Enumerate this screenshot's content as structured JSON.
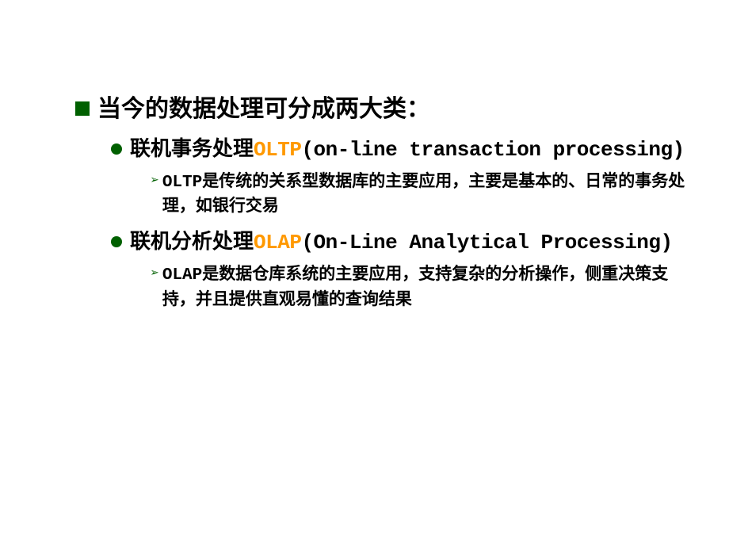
{
  "main": {
    "title": "当今的数据处理可分成两大类：",
    "items": [
      {
        "prefix": "联机事务处理",
        "acronym": "OLTP",
        "suffix": "(on-line transaction processing)",
        "detail": "OLTP是传统的关系型数据库的主要应用，主要是基本的、日常的事务处理，如银行交易"
      },
      {
        "prefix": "联机分析处理",
        "acronym": "OLAP",
        "suffix": "(On-Line Analytical Processing)",
        "detail": "OLAP是数据仓库系统的主要应用，支持复杂的分析操作，侧重决策支持，并且提供直观易懂的查询结果"
      }
    ]
  }
}
